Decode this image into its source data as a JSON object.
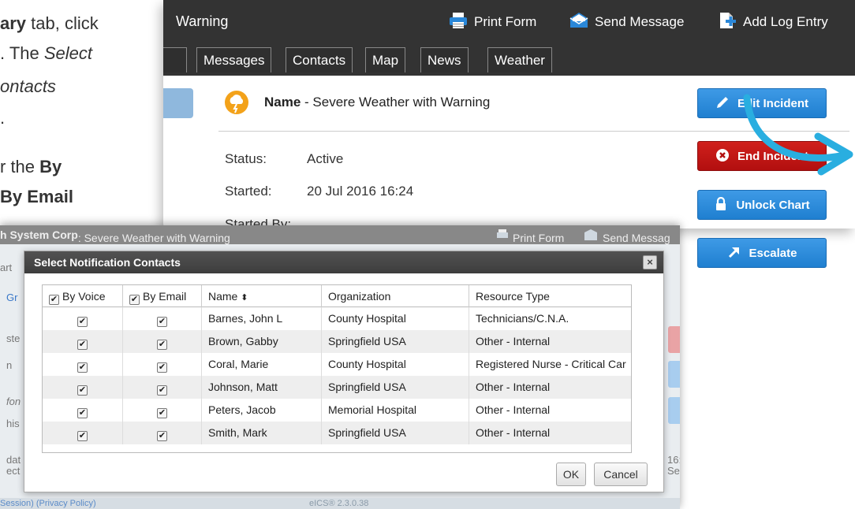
{
  "doc": {
    "line1_bold": "ary",
    "line1_rest": " tab, click",
    "line2_plain": ". The ",
    "line2_italic": "Select",
    "line3_italic": "ontacts",
    "line4": ".",
    "line5_plain": "r the ",
    "line5_bold": "By",
    "line6_bold": "By Email"
  },
  "app": {
    "title": "Warning",
    "actions": {
      "print": "Print Form",
      "send": "Send Message",
      "log": "Add Log Entry"
    },
    "tabs": [
      "Messages",
      "Contacts",
      "Map",
      "News",
      "Weather"
    ],
    "incident": {
      "name_label": "Name",
      "name_value": " - Severe Weather with Warning",
      "status_label": "Status:",
      "status_value": "Active",
      "started_label": "Started:",
      "started_value": "20 Jul 2016 16:24",
      "started_by_label": "Started By:"
    },
    "buttons": {
      "edit": "Edit Incident",
      "end": "End Incident",
      "unlock": "Unlock Chart",
      "escalate": "Escalate"
    },
    "colors": {
      "titlebar": "#333333",
      "blue": "#2a87d8",
      "red": "#c0171a",
      "arrow": "#29aee0",
      "incident_icon": "#f3a21a"
    }
  },
  "dialog_window": {
    "title_bold": "h System Corp",
    "title_rest": ": Severe Weather with Warning",
    "print": "Print Form",
    "send": "Send Messag",
    "left_fragments": [
      "art",
      "Gr",
      "ste",
      "n",
      "fon",
      "his",
      "dat",
      "ect"
    ],
    "right_fragments": [
      "16:",
      "Se"
    ],
    "footer_left": "Session)  (Privacy Policy)",
    "footer_mid": "eICS® 2.3.0.38"
  },
  "modal": {
    "title": "Select Notification Contacts",
    "close_glyph": "×",
    "close_text": "close",
    "columns": {
      "by_voice": "By Voice",
      "by_email": "By Email",
      "name": "Name",
      "name_sort": "⬍",
      "organization": "Organization",
      "resource_type": "Resource Type"
    },
    "check_glyph": "✔",
    "rows": [
      {
        "voice": true,
        "email": true,
        "name": "Barnes, John L",
        "organization": "County Hospital",
        "resource_type": "Technicians/C.N.A."
      },
      {
        "voice": true,
        "email": true,
        "name": "Brown, Gabby",
        "organization": "Springfield USA",
        "resource_type": "Other - Internal"
      },
      {
        "voice": true,
        "email": true,
        "name": "Coral, Marie",
        "organization": "County Hospital",
        "resource_type": "Registered Nurse - Critical Car"
      },
      {
        "voice": true,
        "email": true,
        "name": "Johnson, Matt",
        "organization": "Springfield USA",
        "resource_type": "Other - Internal"
      },
      {
        "voice": true,
        "email": true,
        "name": "Peters, Jacob",
        "organization": "Memorial Hospital",
        "resource_type": "Other - Internal"
      },
      {
        "voice": true,
        "email": true,
        "name": "Smith, Mark",
        "organization": "Springfield USA",
        "resource_type": "Other - Internal"
      }
    ],
    "ok": "OK",
    "cancel": "Cancel"
  }
}
